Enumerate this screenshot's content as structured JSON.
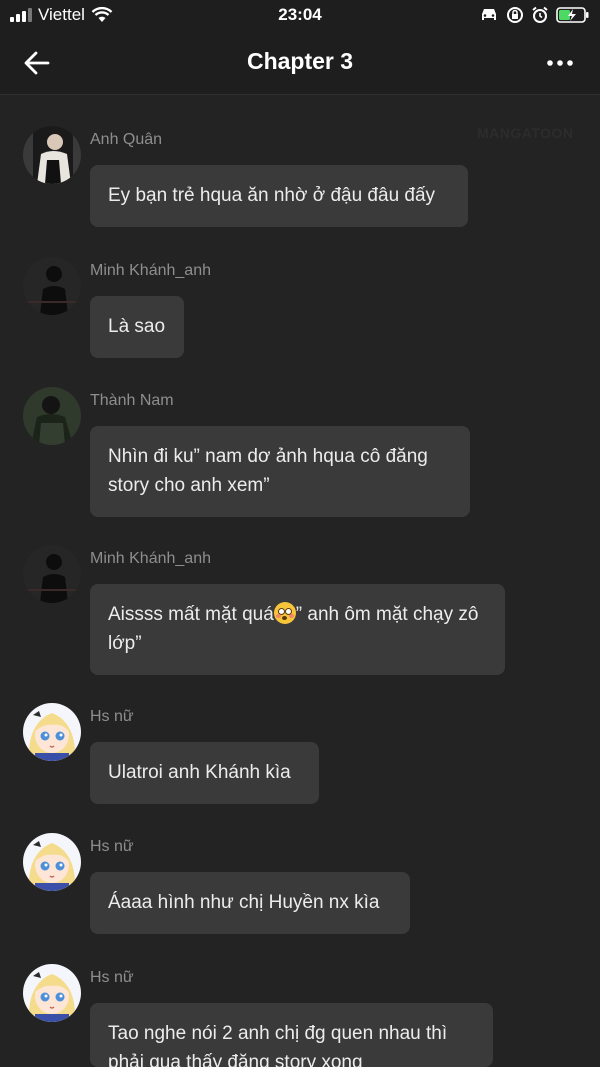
{
  "status_bar": {
    "carrier": "Viettel",
    "time": "23:04"
  },
  "nav": {
    "title": "Chapter 3"
  },
  "watermark": "MANGATOON",
  "messages": [
    {
      "sender": "Anh Quân",
      "avatar": "boy-dark-photo-avatar",
      "text": "Ey bạn trẻ hqua ăn nhờ ở đậu đâu đấy"
    },
    {
      "sender": "Minh Khánh_anh",
      "avatar": "boy-silhouette-avatar",
      "text": "Là sao"
    },
    {
      "sender": "Thành Nam",
      "avatar": "boy-green-photo-avatar",
      "text": "Nhìn đi ku” nam dơ ảnh hqua cô đăng story cho anh xem”"
    },
    {
      "sender": "Minh Khánh_anh",
      "avatar": "boy-silhouette-avatar",
      "text_before_emoji": "Aissss mất mặt quá",
      "emoji": "flushed-face-emoji",
      "text_after_emoji": "” anh ôm mặt chạy zô lớp”"
    },
    {
      "sender": "Hs nữ",
      "avatar": "anime-girl-avatar",
      "text": "Ulatroi anh Khánh kìa"
    },
    {
      "sender": "Hs nữ",
      "avatar": "anime-girl-avatar",
      "text": "Áaaa hình như chị Huyền nx kìa"
    },
    {
      "sender": "Hs nữ",
      "avatar": "anime-girl-avatar",
      "text": "Tao nghe nói 2 anh chị đg quen nhau thì phải qua thấy đăng story xong"
    }
  ]
}
